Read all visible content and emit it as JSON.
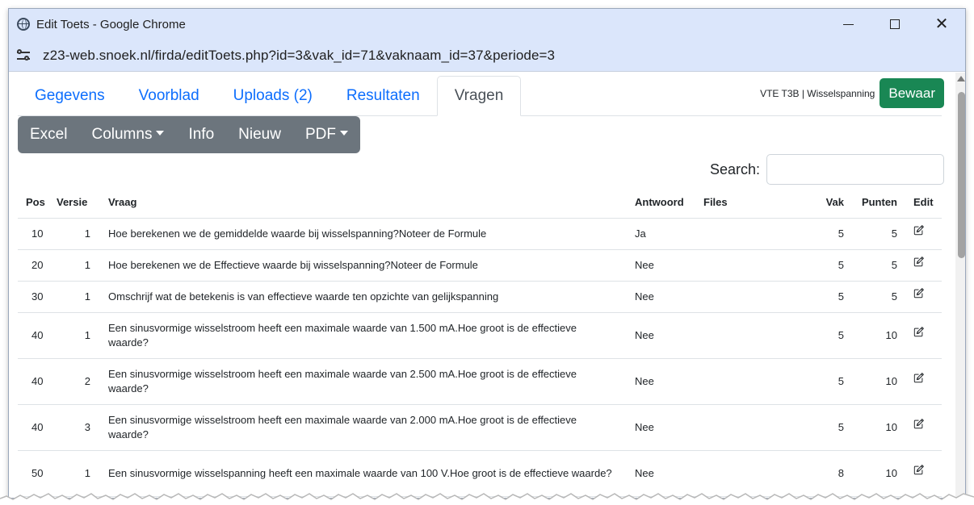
{
  "window": {
    "title": "Edit Toets - Google Chrome",
    "url": "z23-web.snoek.nl/firda/editToets.php?id=3&vak_id=71&vaknaam_id=37&periode=3"
  },
  "tabs": [
    {
      "label": "Gegevens"
    },
    {
      "label": "Voorblad"
    },
    {
      "label": "Uploads (2)"
    },
    {
      "label": "Resultaten"
    },
    {
      "label": "Vragen"
    }
  ],
  "header": {
    "crumb": "VTE T3B | Wisselspanning",
    "save_label": "Bewaar"
  },
  "toolbar": {
    "excel": "Excel",
    "columns": "Columns",
    "info": "Info",
    "nieuw": "Nieuw",
    "pdf": "PDF"
  },
  "search": {
    "label": "Search:",
    "value": ""
  },
  "table": {
    "headers": {
      "pos": "Pos",
      "versie": "Versie",
      "vraag": "Vraag",
      "antwoord": "Antwoord",
      "files": "Files",
      "vak": "Vak",
      "punten": "Punten",
      "edit": "Edit"
    },
    "rows": [
      {
        "pos": "10",
        "versie": "1",
        "vraag": "Hoe berekenen we de gemiddelde waarde bij wisselspanning?Noteer de Formule",
        "antwoord": "Ja",
        "files": "",
        "vak": "5",
        "punten": "5"
      },
      {
        "pos": "20",
        "versie": "1",
        "vraag": "Hoe berekenen we de Effectieve waarde bij wisselspanning?Noteer de Formule",
        "antwoord": "Nee",
        "files": "",
        "vak": "5",
        "punten": "5"
      },
      {
        "pos": "30",
        "versie": "1",
        "vraag": "Omschrijf wat de betekenis is van effectieve waarde ten opzichte van gelijkspanning",
        "antwoord": "Nee",
        "files": "",
        "vak": "5",
        "punten": "5"
      },
      {
        "pos": "40",
        "versie": "1",
        "vraag": "Een sinusvormige wisselstroom heeft een maximale waarde van 1.500 mA.Hoe groot is de effectieve waarde?",
        "antwoord": "Nee",
        "files": "",
        "vak": "5",
        "punten": "10"
      },
      {
        "pos": "40",
        "versie": "2",
        "vraag": "Een sinusvormige wisselstroom heeft een maximale waarde van 2.500 mA.Hoe groot is de effectieve waarde?",
        "antwoord": "Nee",
        "files": "",
        "vak": "5",
        "punten": "10"
      },
      {
        "pos": "40",
        "versie": "3",
        "vraag": "Een sinusvormige wisselstroom heeft een maximale waarde van 2.000 mA.Hoe groot is de effectieve waarde?",
        "antwoord": "Nee",
        "files": "",
        "vak": "5",
        "punten": "10"
      },
      {
        "pos": "50",
        "versie": "1",
        "vraag": "Een sinusvormige wisselspanning heeft een maximale waarde van 100 V.Hoe groot is de effectieve waarde?",
        "antwoord": "Nee",
        "files": "",
        "vak": "8",
        "punten": "10"
      }
    ]
  }
}
